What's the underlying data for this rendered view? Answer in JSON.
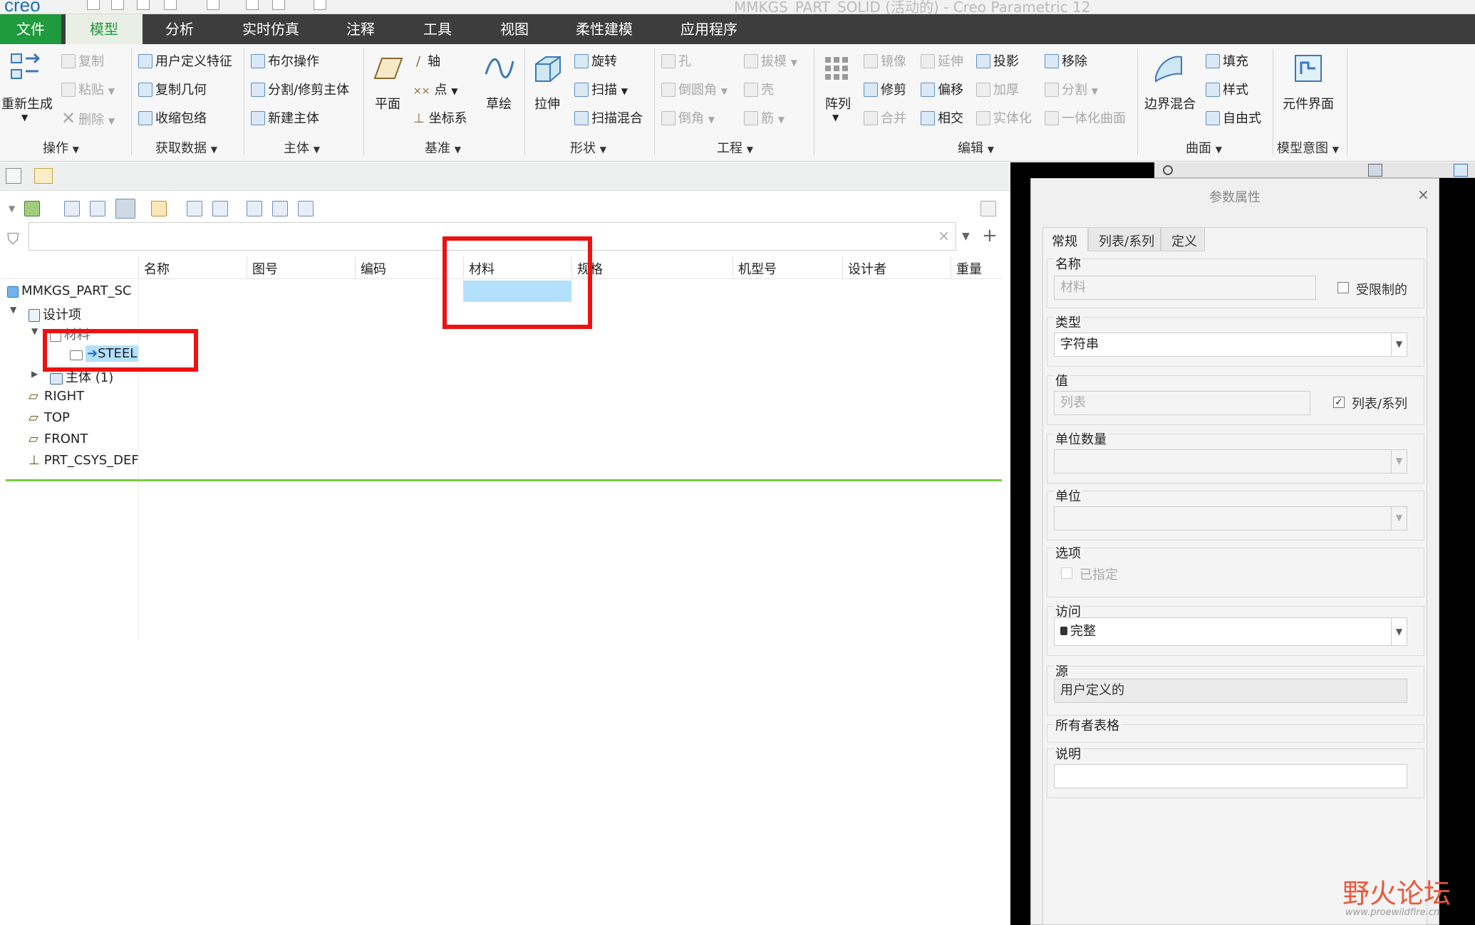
{
  "app": {
    "logo": "creo",
    "window_title": "MMKGS_PART_SOLID (活动的) - Creo Parametric 12"
  },
  "tabs": [
    "文件",
    "模型",
    "分析",
    "实时仿真",
    "注释",
    "工具",
    "视图",
    "柔性建模",
    "应用程序"
  ],
  "ribbon": {
    "operations": {
      "regenerate": "重新生成",
      "copy": "复制",
      "paste": "粘贴",
      "delete": "删除",
      "group": "操作"
    },
    "get_data": {
      "udf": "用户定义特征",
      "copy_geom": "复制几何",
      "shrinkwrap": "收缩包络",
      "group": "获取数据"
    },
    "body": {
      "boolean": "布尔操作",
      "split": "分割/修剪主体",
      "new_body": "新建主体",
      "group": "主体"
    },
    "datum": {
      "plane": "平面",
      "axis": "轴",
      "point": "点",
      "csys": "坐标系",
      "sketch": "草绘",
      "group": "基准"
    },
    "shapes": {
      "extrude": "拉伸",
      "revolve": "旋转",
      "sweep": "扫描",
      "swept_blend": "扫描混合",
      "group": "形状"
    },
    "engineering": {
      "hole": "孔",
      "round": "倒圆角",
      "chamfer": "倒角",
      "draft": "拔模",
      "shell": "壳",
      "rib": "筋",
      "group": "工程"
    },
    "editing": {
      "pattern": "阵列",
      "mirror": "镜像",
      "extend": "延伸",
      "project": "投影",
      "trim": "修剪",
      "offset": "偏移",
      "thicken": "加厚",
      "merge": "合并",
      "intersect": "相交",
      "solidify": "实体化",
      "remove": "移除",
      "split": "分割",
      "unify": "一体化曲面",
      "group": "编辑"
    },
    "surfaces": {
      "boundary_blend": "边界混合",
      "fill": "填充",
      "style": "样式",
      "freestyle": "自由式",
      "group": "曲面"
    },
    "model_intent": {
      "component_interface": "元件界面",
      "group": "模型意图"
    }
  },
  "table": {
    "columns": [
      "名称",
      "图号",
      "编码",
      "材料",
      "规格",
      "机型号",
      "设计者",
      "重量"
    ]
  },
  "tree": {
    "root": "MMKGS_PART_SC",
    "design_items": "设计项",
    "material_folder": "材料",
    "material_value": "STEEL",
    "bodies": "主体 (1)",
    "right": "RIGHT",
    "top": "TOP",
    "front": "FRONT",
    "csys": "PRT_CSYS_DEF"
  },
  "dialog": {
    "title": "参数属性",
    "tabs": [
      "常规",
      "列表/系列",
      "定义"
    ],
    "name_label": "名称",
    "name_value": "材料",
    "restricted_label": "受限制的",
    "type_label": "类型",
    "type_value": "字符串",
    "value_label": "值",
    "value_value": "列表",
    "list_series_label": "列表/系列",
    "list_series_checked": true,
    "unit_qty_label": "单位数量",
    "unit_label": "单位",
    "options_label": "选项",
    "designated_label": "已指定",
    "access_label": "访问",
    "access_value": "完整",
    "source_label": "源",
    "source_value": "用户定义的",
    "owner_table_label": "所有者表格",
    "description_label": "说明"
  },
  "watermark": {
    "text": "野火论坛",
    "url": "www.proewildfire.cn"
  },
  "colors": {
    "file_tab": "#1f9a3c",
    "tab_bar": "#3d3d3d",
    "highlight": "#ee1111",
    "selection": "#b3e0ff"
  }
}
